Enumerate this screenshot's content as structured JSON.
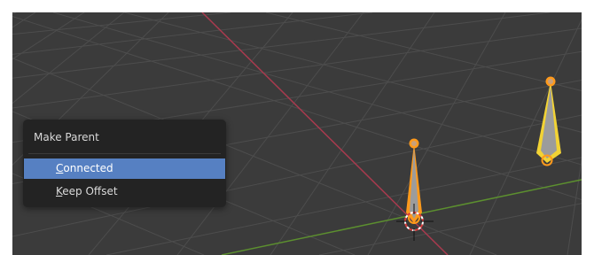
{
  "menu": {
    "title": "Make Parent",
    "items": [
      {
        "first": "C",
        "rest": "onnected",
        "active": true
      },
      {
        "first": "K",
        "rest": "eep Offset",
        "active": false
      }
    ]
  },
  "colors": {
    "viewport_bg": "#3b3b3b",
    "grid_line": "#4c4c4c",
    "x_axis": "#a83a4e",
    "y_axis": "#5c8f2f",
    "menu_bg": "#232323",
    "menu_highlight": "#5680c2",
    "bone_active": "#ff9a1c",
    "bone_selected": "#f2d335"
  },
  "icons": {
    "cursor": "3d-cursor-icon",
    "bone": "bone-icon"
  }
}
